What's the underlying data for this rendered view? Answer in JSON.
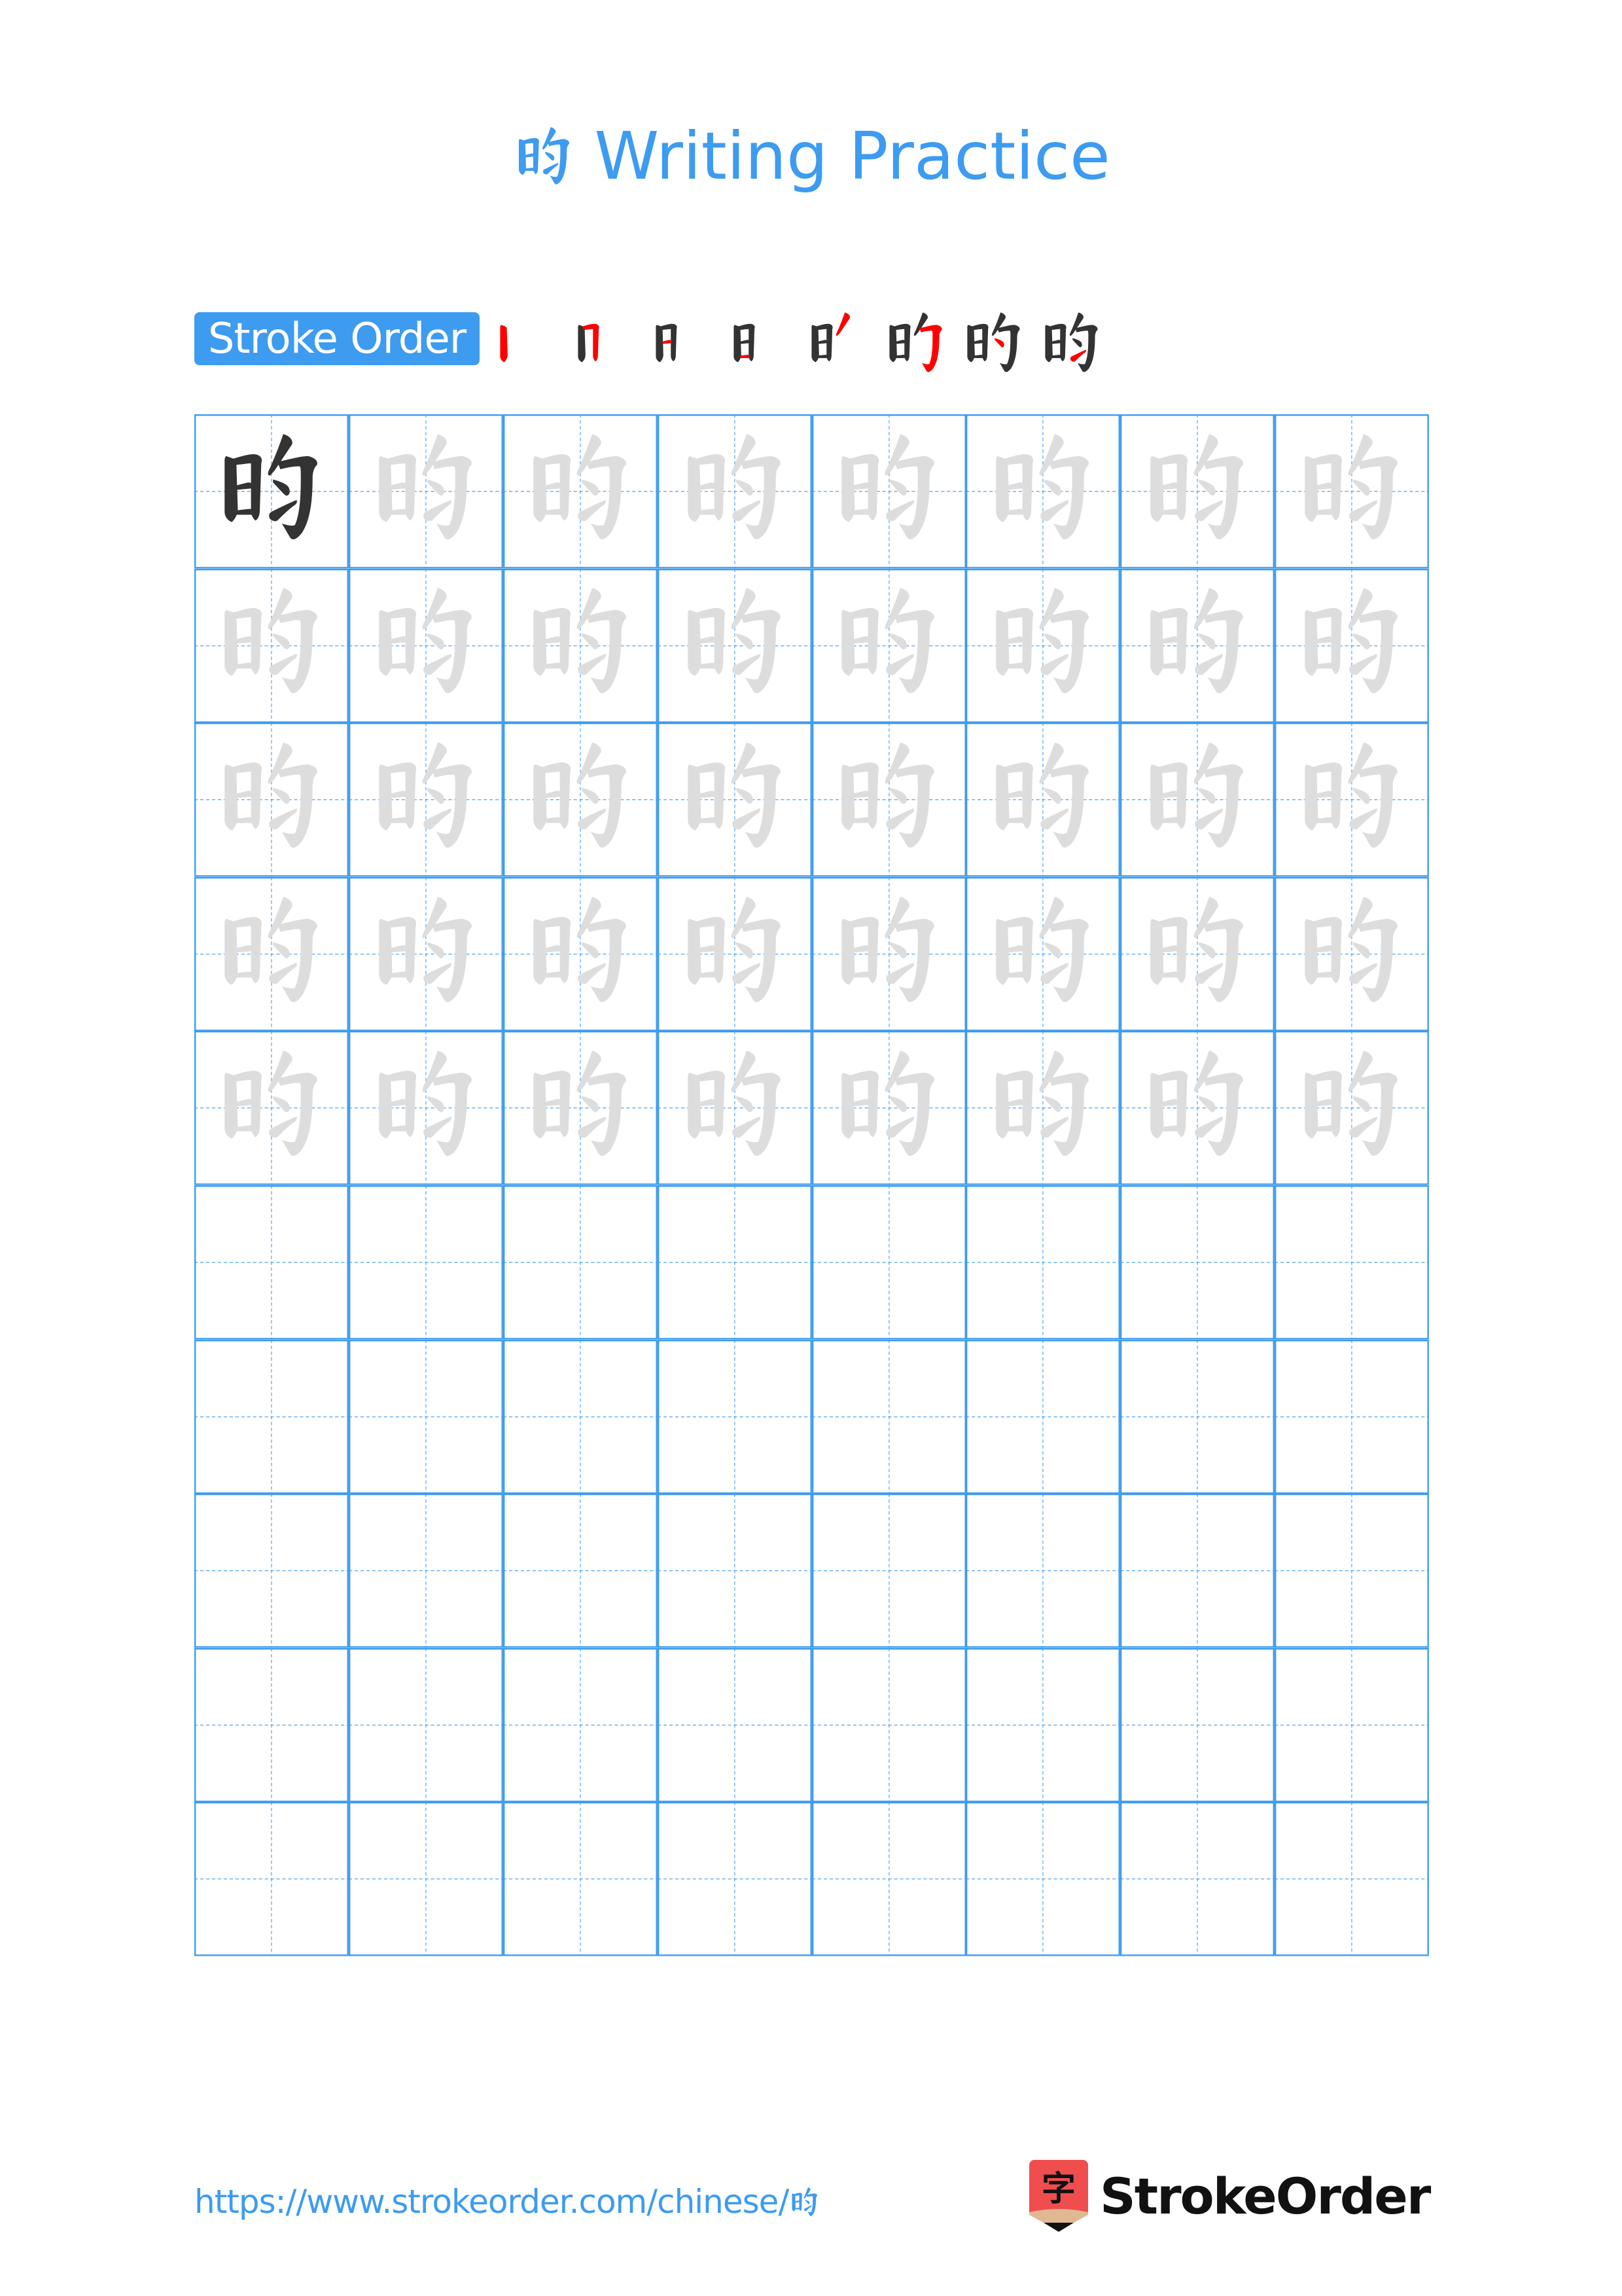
{
  "page": {
    "character": "昀",
    "title_suffix": "Writing Practice",
    "title_full": "昀 Writing Practice"
  },
  "stroke_order": {
    "label": "Stroke Order",
    "stroke_count": 8,
    "steps": [
      1,
      2,
      3,
      4,
      5,
      6,
      7,
      8
    ],
    "highlight_color": "#ff0000",
    "done_color": "#333333"
  },
  "practice_grid": {
    "columns": 8,
    "rows": 10,
    "model_cells": 1,
    "traced_rows": 5,
    "blank_rows": 5,
    "line_color": "#3d9bf0",
    "model_color": "#333333",
    "trace_color": "#dddddd"
  },
  "footer": {
    "url_text": "https://www.strokeorder.com/chinese/",
    "url_char": "昀",
    "logo_icon_char": "字",
    "logo_text": "StrokeOrder",
    "logo_red": "#f04e4e",
    "logo_tan": "#e0b992"
  }
}
